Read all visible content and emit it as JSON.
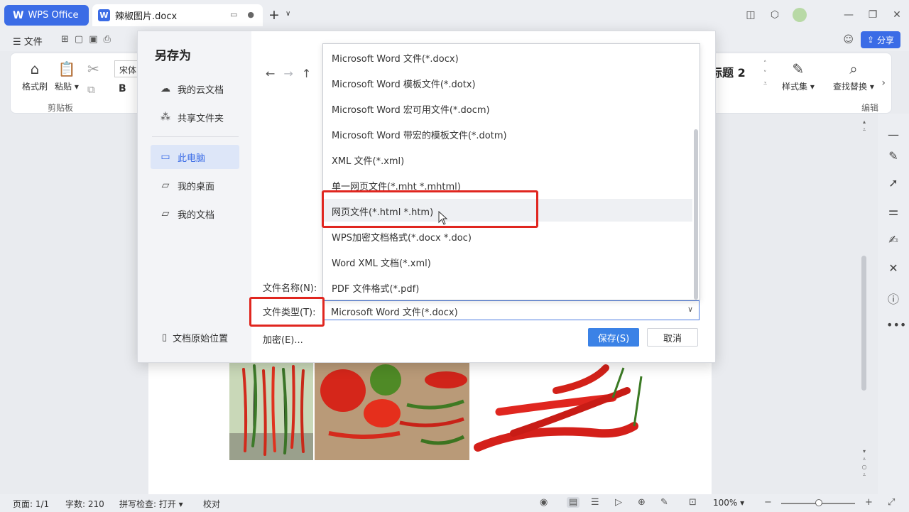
{
  "titlebar": {
    "app_label": "WPS Office",
    "doc_tab_label": "辣椒图片.docx"
  },
  "menu": {
    "file_label": "文件",
    "share_label": "分享"
  },
  "ribbon": {
    "format_painter": "格式刷",
    "paste": "粘贴",
    "clipboard_group": "剪贴板",
    "font_name": "宋体",
    "bold": "B",
    "heading_style": "标题 2",
    "styles": "样式集",
    "find_replace": "查找替换",
    "edit_group": "编辑"
  },
  "dialog": {
    "title": "另存为",
    "nav": {
      "cloud": "我的云文档",
      "shared": "共享文件夹",
      "this_pc": "此电脑",
      "desktop": "我的桌面",
      "documents": "我的文档"
    },
    "original_location": "文档原始位置",
    "filename_label": "文件名称(N):",
    "filetype_label": "文件类型(T):",
    "filetype_value": "Microsoft Word 文件(*.docx)",
    "encrypt_label": "加密(E)...",
    "save_label": "保存(S)",
    "cancel_label": "取消",
    "filetype_options": [
      "Microsoft Word 文件(*.docx)",
      "Microsoft Word 模板文件(*.dotx)",
      "Microsoft Word 宏可用文件(*.docm)",
      "Microsoft Word 带宏的模板文件(*.dotm)",
      "XML 文件(*.xml)",
      "单一网页文件(*.mht *.mhtml)",
      "网页文件(*.html *.htm)",
      "WPS加密文档格式(*.docx *.doc)",
      "Word XML 文档(*.xml)",
      "PDF 文件格式(*.pdf)"
    ],
    "hovered_option_index": 6
  },
  "status": {
    "page": "页面: 1/1",
    "word_count": "字数: 210",
    "spell_check": "拼写检查: 打开",
    "proofread": "校对",
    "zoom": "100%"
  },
  "colors": {
    "accent": "#3b6ce6",
    "highlight": "#e0261f"
  }
}
